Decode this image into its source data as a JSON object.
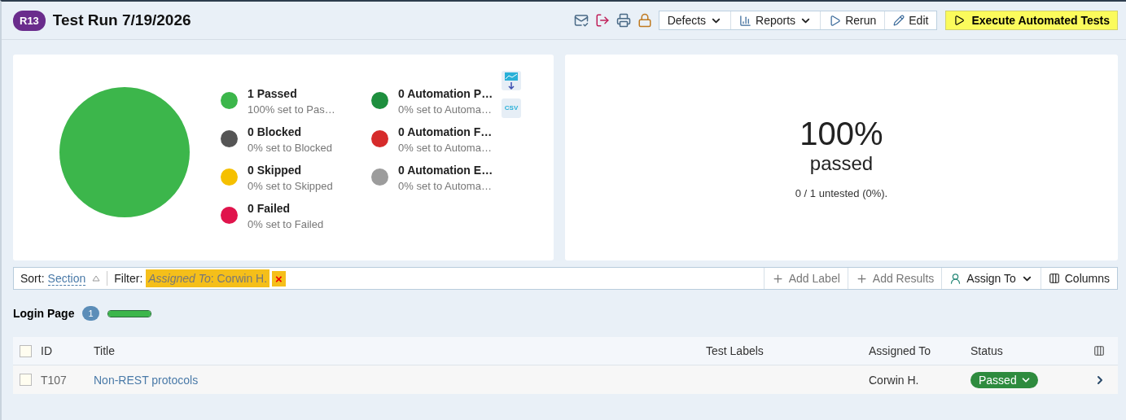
{
  "header": {
    "badge": "R13",
    "title": "Test Run 7/19/2026",
    "buttons": [
      {
        "label": "Defects",
        "kind": "menu",
        "caret": true
      },
      {
        "label": "Reports",
        "kind": "report",
        "caret": true
      },
      {
        "label": "Rerun",
        "kind": "rerun",
        "caret": false
      },
      {
        "label": "Edit",
        "kind": "edit",
        "caret": false
      }
    ],
    "primary": "Execute Automated Tests"
  },
  "summary": {
    "legend": [
      {
        "label": "1 Passed",
        "sub": "100% set to Pas…",
        "color": "#3cb64b"
      },
      {
        "label": "0 Blocked",
        "sub": "0% set to Blocked",
        "color": "#555555"
      },
      {
        "label": "0 Skipped",
        "sub": "0% set to Skipped",
        "color": "#f5c000"
      },
      {
        "label": "0 Failed",
        "sub": "0% set to Failed",
        "color": "#e0144c"
      },
      {
        "label": "0 Automation P…",
        "sub": "0% set to Automa…",
        "color": "#1e8f3e"
      },
      {
        "label": "0 Automation F…",
        "sub": "0% set to Automa…",
        "color": "#d62b2b"
      },
      {
        "label": "0 Automation E…",
        "sub": "0% set to Automa…",
        "color": "#9c9c9c"
      }
    ],
    "csv": "CSV",
    "percent": "100%",
    "passed": "passed",
    "untested": "0 / 1 untested (0%)."
  },
  "toolbar": {
    "sort_label": "Sort:",
    "sort_value": "Section",
    "filter_label": "Filter:",
    "filter_key": "Assigned To",
    "filter_value": ": Corwin H.",
    "remove": "×",
    "actions": [
      {
        "label": "Add Label",
        "kind": "add",
        "caret": false
      },
      {
        "label": "Add Results",
        "kind": "add",
        "caret": false
      },
      {
        "label": "Assign To",
        "kind": "assign",
        "caret": true
      },
      {
        "label": "Columns",
        "kind": "columns",
        "caret": false
      }
    ]
  },
  "section": {
    "title": "Login Page",
    "count": "1",
    "level": 1
  },
  "table": {
    "columns": [
      "ID",
      "Title",
      "Test Labels",
      "Assigned To",
      "Status"
    ],
    "header_checked": false,
    "rows": [
      {
        "checked": false,
        "id": "T107",
        "title": "Non-REST protocols",
        "labels": "",
        "assigned": "Corwin H.",
        "status": "Passed"
      }
    ]
  }
}
